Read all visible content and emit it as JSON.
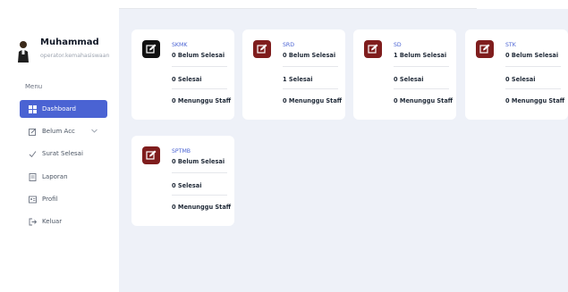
{
  "user": {
    "name": "Muhammad",
    "role": "operator.kemahasiswaan"
  },
  "sidebar": {
    "menu_label": "Menu",
    "items": [
      {
        "label": "Dashboard",
        "icon": "grid-icon",
        "active": true
      },
      {
        "label": "Belum Acc",
        "icon": "edit-icon",
        "has_chevron": true
      },
      {
        "label": "Surat Selesai",
        "icon": "check-icon"
      },
      {
        "label": "Laporan",
        "icon": "document-icon"
      },
      {
        "label": "Profil",
        "icon": "id-card-icon"
      },
      {
        "label": "Keluar",
        "icon": "logout-icon"
      }
    ]
  },
  "cards": [
    {
      "title": "SKMK",
      "icon_color": "#111111",
      "belum": "0 Belum Selesai",
      "selesai": "0 Selesai",
      "menunggu": "0 Menunggu Staff"
    },
    {
      "title": "SRD",
      "icon_color": "#7f1d1d",
      "belum": "0 Belum Selesai",
      "selesai": "1 Selesai",
      "menunggu": "0 Menunggu Staff"
    },
    {
      "title": "SD",
      "icon_color": "#7f1d1d",
      "belum": "1 Belum Selesai",
      "selesai": "0 Selesai",
      "menunggu": "0 Menunggu Staff"
    },
    {
      "title": "STK",
      "icon_color": "#7f1d1d",
      "belum": "0 Belum Selesai",
      "selesai": "0 Selesai",
      "menunggu": "0 Menunggu Staff"
    },
    {
      "title": "SPTMB",
      "icon_color": "#7f1d1d",
      "belum": "0 Belum Selesai",
      "selesai": "0 Selesai",
      "menunggu": "0 Menunggu Staff"
    }
  ],
  "colors": {
    "accent": "#4a63d3",
    "background": "#eef1f8",
    "icon_dark": "#111111",
    "icon_maroon": "#7f1d1d"
  }
}
